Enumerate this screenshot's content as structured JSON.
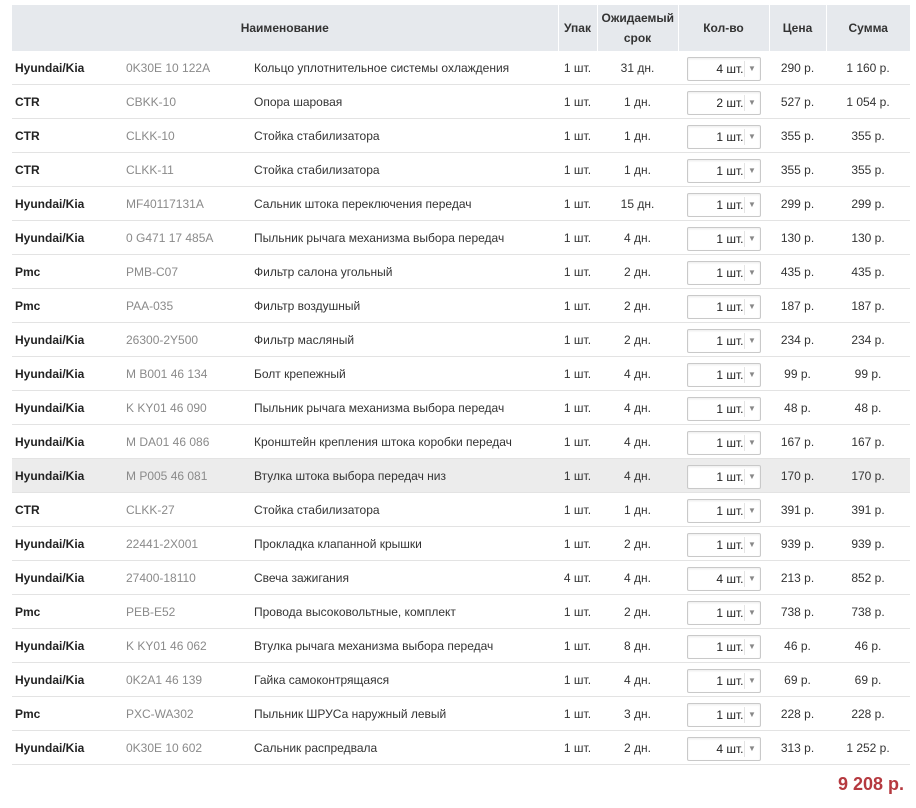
{
  "columns": {
    "name": "Наименование",
    "pack": "Упак",
    "days": "Ожидаемый срок",
    "qty": "Кол-во",
    "price": "Цена",
    "sum": "Сумма"
  },
  "rows": [
    {
      "brand": "Hyundai/Kia",
      "article": "0K30E 10 122A",
      "name": "Кольцо уплотнительное системы охлаждения",
      "pack": "1 шт.",
      "days": "31 дн.",
      "qty": "4 шт.",
      "price": "290 р.",
      "sum": "1 160 р."
    },
    {
      "brand": "CTR",
      "article": "CBKK-10",
      "name": "Опора шаровая",
      "pack": "1 шт.",
      "days": "1 дн.",
      "qty": "2 шт.",
      "price": "527 р.",
      "sum": "1 054 р."
    },
    {
      "brand": "CTR",
      "article": "CLKK-10",
      "name": "Стойка стабилизатора",
      "pack": "1 шт.",
      "days": "1 дн.",
      "qty": "1 шт.",
      "price": "355 р.",
      "sum": "355 р."
    },
    {
      "brand": "CTR",
      "article": "CLKK-11",
      "name": "Стойка стабилизатора",
      "pack": "1 шт.",
      "days": "1 дн.",
      "qty": "1 шт.",
      "price": "355 р.",
      "sum": "355 р."
    },
    {
      "brand": "Hyundai/Kia",
      "article": "MF40117131A",
      "name": "Сальник штока переключения передач",
      "pack": "1 шт.",
      "days": "15 дн.",
      "qty": "1 шт.",
      "price": "299 р.",
      "sum": "299 р."
    },
    {
      "brand": "Hyundai/Kia",
      "article": "0 G471 17 485A",
      "name": "Пыльник рычага механизма выбора передач",
      "pack": "1 шт.",
      "days": "4 дн.",
      "qty": "1 шт.",
      "price": "130 р.",
      "sum": "130 р."
    },
    {
      "brand": "Pmc",
      "article": "PMB-C07",
      "name": "Фильтр салона угольный",
      "pack": "1 шт.",
      "days": "2 дн.",
      "qty": "1 шт.",
      "price": "435 р.",
      "sum": "435 р."
    },
    {
      "brand": "Pmc",
      "article": "PAA-035",
      "name": "Фильтр воздушный",
      "pack": "1 шт.",
      "days": "2 дн.",
      "qty": "1 шт.",
      "price": "187 р.",
      "sum": "187 р."
    },
    {
      "brand": "Hyundai/Kia",
      "article": "26300-2Y500",
      "name": "Фильтр масляный",
      "pack": "1 шт.",
      "days": "2 дн.",
      "qty": "1 шт.",
      "price": "234 р.",
      "sum": "234 р."
    },
    {
      "brand": "Hyundai/Kia",
      "article": "M B001 46 134",
      "name": "Болт крепежный",
      "pack": "1 шт.",
      "days": "4 дн.",
      "qty": "1 шт.",
      "price": "99 р.",
      "sum": "99 р."
    },
    {
      "brand": "Hyundai/Kia",
      "article": "K KY01 46 090",
      "name": "Пыльник рычага механизма выбора передач",
      "pack": "1 шт.",
      "days": "4 дн.",
      "qty": "1 шт.",
      "price": "48 р.",
      "sum": "48 р."
    },
    {
      "brand": "Hyundai/Kia",
      "article": "M DA01 46 086",
      "name": "Кронштейн крепления штока коробки передач",
      "pack": "1 шт.",
      "days": "4 дн.",
      "qty": "1 шт.",
      "price": "167 р.",
      "sum": "167 р."
    },
    {
      "brand": "Hyundai/Kia",
      "article": "M P005 46 081",
      "name": "Втулка штока выбора передач низ",
      "pack": "1 шт.",
      "days": "4 дн.",
      "qty": "1 шт.",
      "price": "170 р.",
      "sum": "170 р.",
      "highlight": true
    },
    {
      "brand": "CTR",
      "article": "CLKK-27",
      "name": "Стойка стабилизатора",
      "pack": "1 шт.",
      "days": "1 дн.",
      "qty": "1 шт.",
      "price": "391 р.",
      "sum": "391 р."
    },
    {
      "brand": "Hyundai/Kia",
      "article": "22441-2X001",
      "name": "Прокладка клапанной крышки",
      "pack": "1 шт.",
      "days": "2 дн.",
      "qty": "1 шт.",
      "price": "939 р.",
      "sum": "939 р."
    },
    {
      "brand": "Hyundai/Kia",
      "article": "27400-18110",
      "name": "Свеча зажигания",
      "pack": "4 шт.",
      "days": "4 дн.",
      "qty": "4 шт.",
      "price": "213 р.",
      "sum": "852 р."
    },
    {
      "brand": "Pmc",
      "article": "PEB-E52",
      "name": "Провода высоковольтные, комплект",
      "pack": "1 шт.",
      "days": "2 дн.",
      "qty": "1 шт.",
      "price": "738 р.",
      "sum": "738 р."
    },
    {
      "brand": "Hyundai/Kia",
      "article": "K KY01 46 062",
      "name": "Втулка рычага механизма выбора передач",
      "pack": "1 шт.",
      "days": "8 дн.",
      "qty": "1 шт.",
      "price": "46 р.",
      "sum": "46 р."
    },
    {
      "brand": "Hyundai/Kia",
      "article": "0K2A1 46 139",
      "name": "Гайка самоконтрящаяся",
      "pack": "1 шт.",
      "days": "4 дн.",
      "qty": "1 шт.",
      "price": "69 р.",
      "sum": "69 р."
    },
    {
      "brand": "Pmc",
      "article": "PXC-WA302",
      "name": "Пыльник ШРУСа наружный левый",
      "pack": "1 шт.",
      "days": "3 дн.",
      "qty": "1 шт.",
      "price": "228 р.",
      "sum": "228 р."
    },
    {
      "brand": "Hyundai/Kia",
      "article": "0K30E 10 602",
      "name": "Сальник распредвала",
      "pack": "1 шт.",
      "days": "2 дн.",
      "qty": "4 шт.",
      "price": "313 р.",
      "sum": "1 252 р."
    }
  ],
  "total": "9 208 р.",
  "colors": {
    "header_bg": "#e6e9ed",
    "highlight_row": "#ececec",
    "total": "#b5393f"
  }
}
